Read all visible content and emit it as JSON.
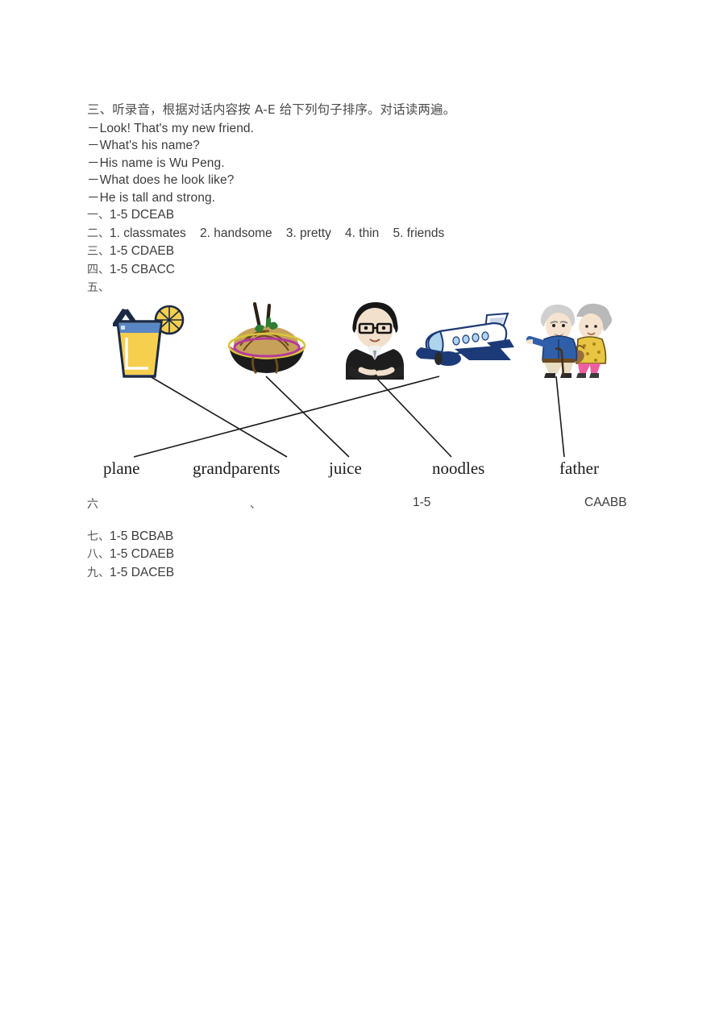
{
  "document": {
    "section_heading": "三、听录音，根据对话内容按 A-E 给下列句子排序。对话读两遍。",
    "dialogue": [
      "－Look! That's my new friend.",
      "－What's his name?",
      "－His name is Wu Peng.",
      "－What does he look like?",
      "－He is tall and strong."
    ],
    "answers": [
      {
        "num": "一、",
        "text": "1-5 DCEAB"
      },
      {
        "num": "二、",
        "text": "1. classmates    2. handsome    3. pretty    4. thin    5. friends"
      },
      {
        "num": "三、",
        "text": "1-5 CDAEB"
      },
      {
        "num": "四、",
        "text": "1-5 CBACC"
      },
      {
        "num": "五、",
        "text": ""
      }
    ],
    "spread_answer": {
      "num": "六",
      "separator": "、",
      "range": "1-5",
      "value": "CAABB"
    },
    "tail_answers": [
      {
        "num": "七、",
        "text": "1-5 BCBAB"
      },
      {
        "num": "八、",
        "text": "1-5 CDAEB"
      },
      {
        "num": "九、",
        "text": "1-5 DACEB"
      }
    ]
  },
  "matching": {
    "pictures": [
      {
        "id": "juice-glass",
        "label": "juice-picture"
      },
      {
        "id": "noodles-bowl",
        "label": "noodles-picture"
      },
      {
        "id": "man-father",
        "label": "father-picture"
      },
      {
        "id": "airplane",
        "label": "plane-picture"
      },
      {
        "id": "grandparents",
        "label": "grandparents-picture"
      }
    ],
    "words": [
      "plane",
      "grandparents",
      "juice",
      "noodles",
      "father"
    ],
    "connections": [
      {
        "from": "juice-glass",
        "to": "grandparents"
      },
      {
        "from": "noodles-bowl",
        "to": "juice"
      },
      {
        "from": "man-father",
        "to": "noodles"
      },
      {
        "from": "airplane",
        "to": "plane"
      },
      {
        "from": "grandparents",
        "to": "father"
      }
    ]
  },
  "colors": {
    "text": "#3c3c3c",
    "word_text": "#1c1c1c",
    "line": "#1a1a1a",
    "juice_liquid": "#f6cf4e",
    "juice_rim": "#4f7cc0",
    "noodles_bowl": "#b5399b",
    "plane_body": "#ffffff",
    "plane_accent": "#1c3a77",
    "grandma_dress": "#e8c643",
    "grandpa_coat": "#2f5fa8"
  }
}
